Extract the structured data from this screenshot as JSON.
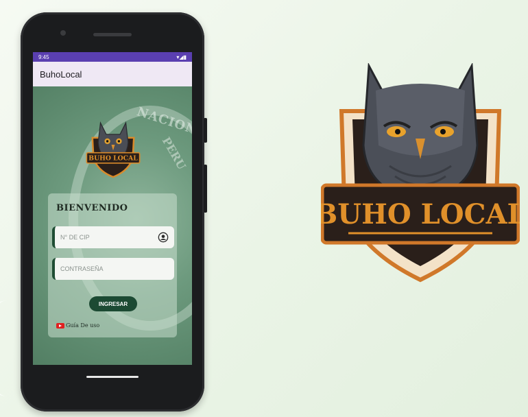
{
  "status_bar": {
    "time": "9:45",
    "icons": "▾◢▮"
  },
  "app_bar": {
    "title": "BuhoLocal"
  },
  "background_emblem": {
    "text_top": "NACION",
    "text_side": "PERU"
  },
  "logo": {
    "text": "BUHO LOCAL"
  },
  "login": {
    "title": "BIENVENIDO",
    "cip_placeholder": "N° DE CIP",
    "password_placeholder": "CONTRASEÑA",
    "submit_label": "INGRESAR",
    "guide_label": "Guía De uso"
  },
  "colors": {
    "accent_dark_green": "#1c4a33",
    "status_bar": "#5a3fb0",
    "app_bar": "#efe8f4",
    "logo_orange": "#e0902a"
  },
  "icons": {
    "user": "account-circle-icon",
    "video": "youtube-icon"
  }
}
